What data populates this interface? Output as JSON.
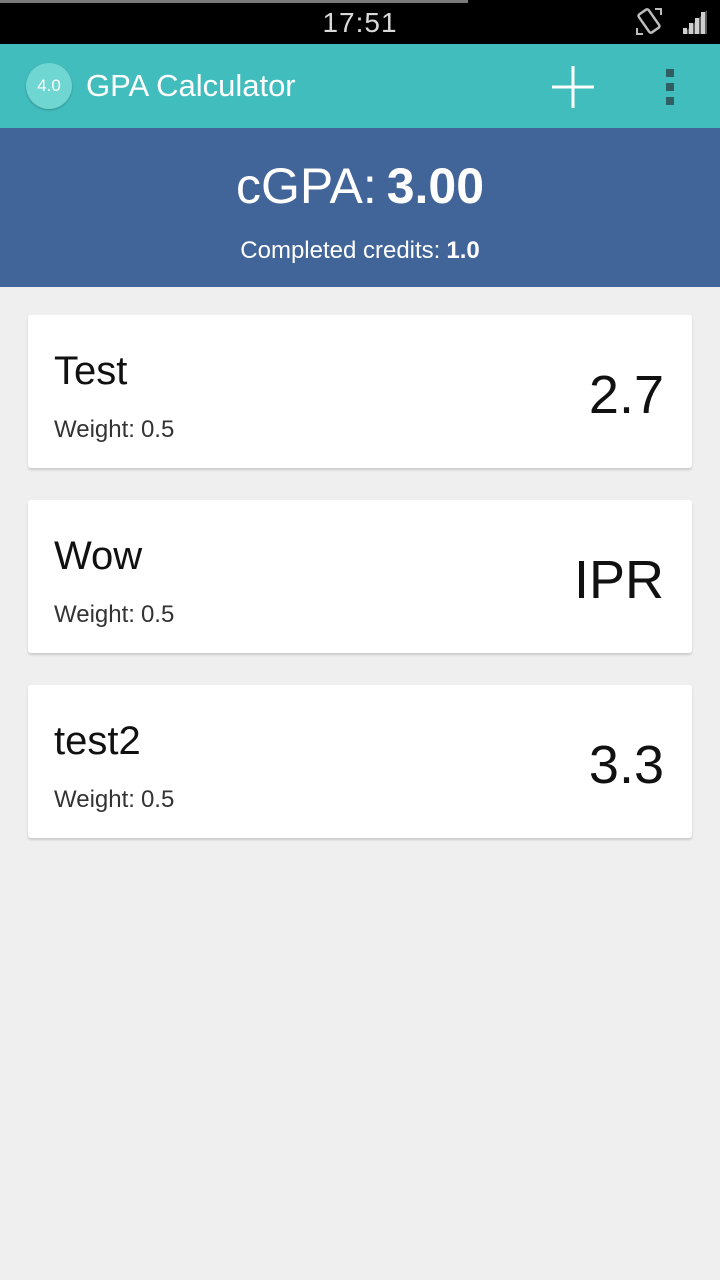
{
  "status_bar": {
    "time": "17:51",
    "icons": [
      "screen-rotate-icon",
      "cell-signal-icon"
    ]
  },
  "action_bar": {
    "app_icon_text": "4.0",
    "title": "GPA Calculator",
    "add_icon": "plus-icon",
    "overflow_icon": "more-vert-icon"
  },
  "summary": {
    "cgpa_label": "cGPA:",
    "cgpa_value": "3.00",
    "credits_label": "Completed credits:",
    "credits_value": "1.0"
  },
  "courses": [
    {
      "name": "Test",
      "weight_label": "Weight:",
      "weight": "0.5",
      "grade": "2.7"
    },
    {
      "name": "Wow",
      "weight_label": "Weight:",
      "weight": "0.5",
      "grade": "IPR"
    },
    {
      "name": "test2",
      "weight_label": "Weight:",
      "weight": "0.5",
      "grade": "3.3"
    }
  ],
  "colors": {
    "action_bar": "#42bdbd",
    "summary_bg": "#416499",
    "background": "#efefef"
  }
}
